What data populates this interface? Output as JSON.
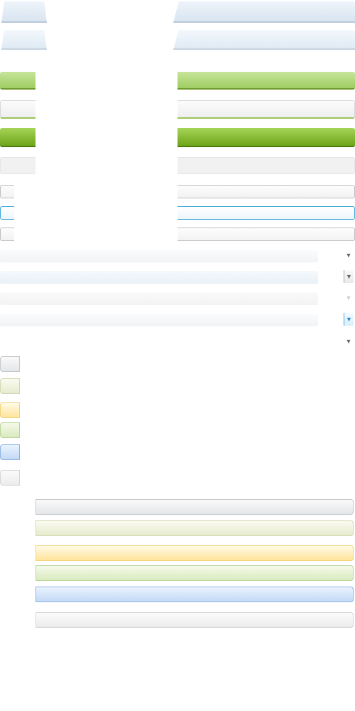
{
  "screen": {
    "description_free": true
  },
  "colors": {
    "tab_blue": "#d9e5f1",
    "green_light": "#a9d46b",
    "green_dark": "#78ad22",
    "input_focus_border": "#3fa9d4",
    "button_yellow": "#ffe49a",
    "button_blue": "#c2d9f5",
    "button_green": "#d9eabf",
    "button_olive": "#e6ebcd",
    "button_grey": "#e4e6e8"
  },
  "icons": {
    "dropdown_arrow": "chevron-down-icon"
  },
  "selects": [
    {
      "id": "select-1",
      "state": "default"
    },
    {
      "id": "select-2",
      "state": "button"
    },
    {
      "id": "select-3",
      "state": "disabled"
    },
    {
      "id": "select-4",
      "state": "active"
    },
    {
      "id": "select-5",
      "state": "plain"
    }
  ],
  "buttons": [
    {
      "variant": "grey"
    },
    {
      "variant": "olive"
    },
    {
      "variant": "yellow"
    },
    {
      "variant": "green"
    },
    {
      "variant": "blue"
    },
    {
      "variant": "light"
    }
  ]
}
